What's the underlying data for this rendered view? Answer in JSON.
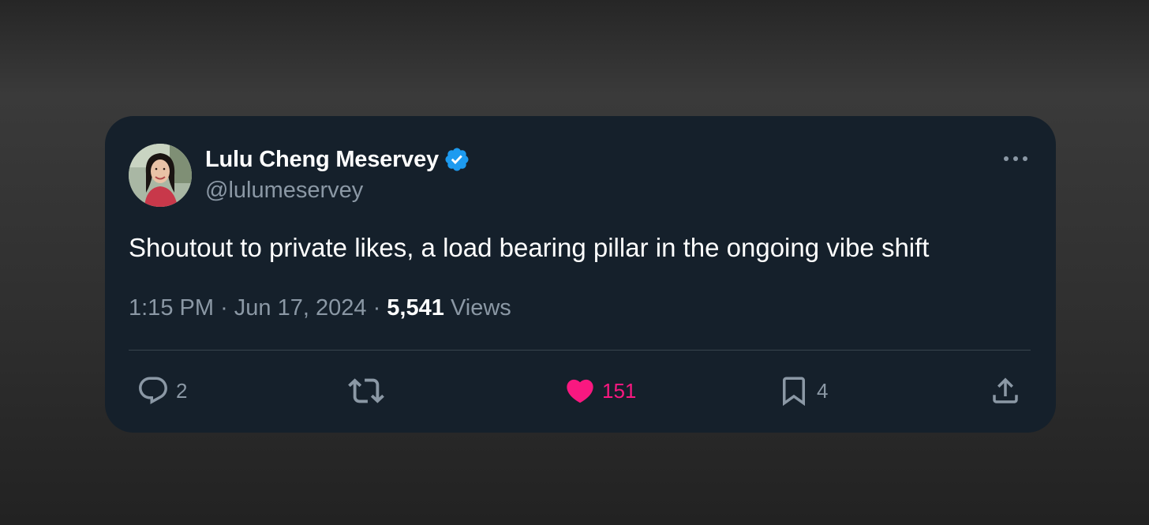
{
  "tweet": {
    "author": {
      "display_name": "Lulu Cheng Meservey",
      "handle": "@lulumeservey",
      "verified": true
    },
    "text": "Shoutout to private likes, a load bearing pillar in the ongoing vibe shift",
    "time": "1:15 PM",
    "date": "Jun 17, 2024",
    "separator": "·",
    "views_count": "5,541",
    "views_label": "Views",
    "actions": {
      "reply": {
        "icon": "reply-icon",
        "count": "2"
      },
      "retweet": {
        "icon": "retweet-icon",
        "count": ""
      },
      "like": {
        "icon": "heart-icon",
        "count": "151",
        "active": true
      },
      "bookmark": {
        "icon": "bookmark-icon",
        "count": "4"
      },
      "share": {
        "icon": "share-icon",
        "count": ""
      }
    }
  },
  "colors": {
    "card_background": "#15202b",
    "primary_text": "#ffffff",
    "secondary_text": "#8b98a5",
    "verified_badge": "#1d9bf0",
    "like_active": "#f91880",
    "divider": "#38444d"
  }
}
